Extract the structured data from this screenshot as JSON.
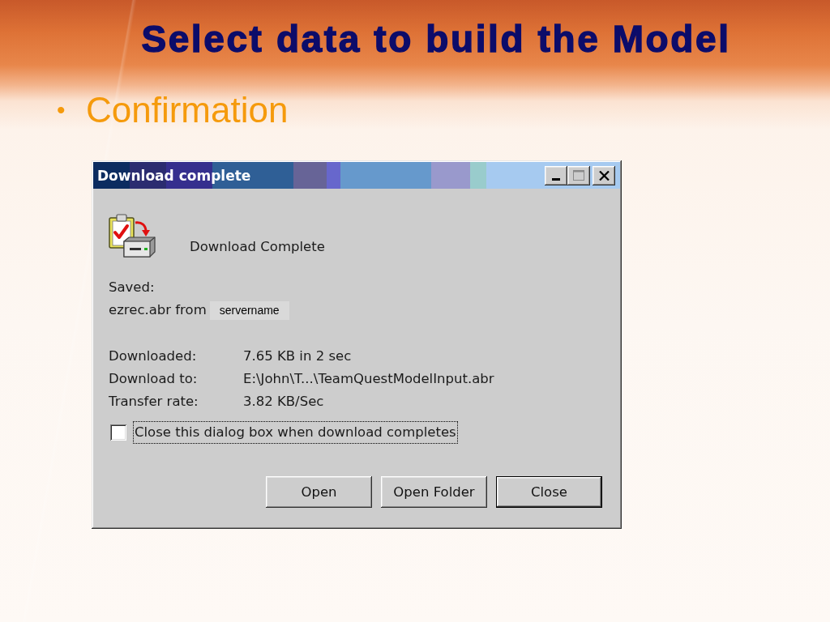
{
  "slide": {
    "title": "Select data to build the Model",
    "bullets": [
      {
        "marker": "•",
        "text": "Confirmation"
      }
    ]
  },
  "dialog": {
    "title": "Download complete",
    "heading": "Download Complete",
    "saved_label": "Saved:",
    "saved_file": "ezrec.abr from",
    "server_label": "servername",
    "details": [
      {
        "label": "Downloaded:",
        "value": "7.65 KB in 2 sec"
      },
      {
        "label": "Download to:",
        "value": "E:\\John\\T...\\TeamQuestModelInput.abr"
      },
      {
        "label": "Transfer rate:",
        "value": "3.82 KB/Sec"
      }
    ],
    "close_when_done": {
      "label": "Close this dialog box when download completes",
      "checked": false,
      "focused": true
    },
    "buttons": [
      {
        "label": "Open",
        "default": false
      },
      {
        "label": "Open Folder",
        "default": false
      },
      {
        "label": "Close",
        "default": true
      }
    ]
  }
}
